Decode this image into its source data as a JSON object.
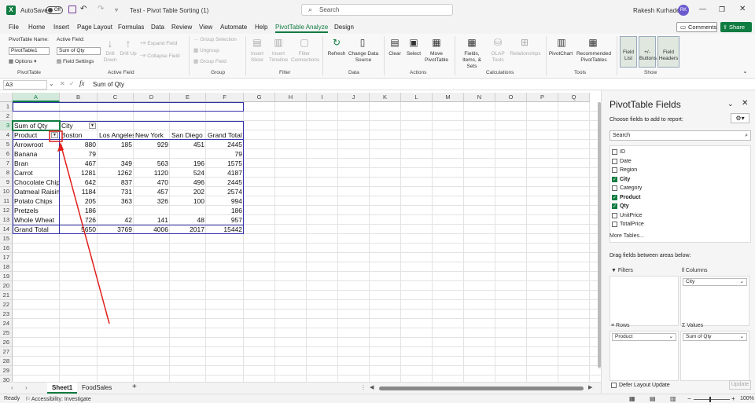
{
  "titlebar": {
    "autosave": "AutoSave",
    "toggle": "Off",
    "title": "Test - Pivot Table Sorting (1)",
    "search": "Search",
    "user": "Rakesh Kurhade",
    "initials": "RK"
  },
  "menu": [
    "File",
    "Home",
    "Insert",
    "Page Layout",
    "Formulas",
    "Data",
    "Review",
    "View",
    "Automate",
    "Help",
    "PivotTable Analyze",
    "Design"
  ],
  "menu_active": "PivotTable Analyze",
  "comments": "Comments",
  "share": "Share",
  "ribbon": {
    "pt_name_label": "PivotTable Name:",
    "pt_name": "PivotTable1",
    "options": "Options",
    "active_field_label": "Active Field:",
    "active_field": "Sum of Qty",
    "field_settings": "Field Settings",
    "drill_down": "Drill Down",
    "drill_up": "Drill Up",
    "expand_field": "Expand Field",
    "collapse_field": "Collapse Field",
    "group_selection": "Group Selection",
    "ungroup": "Ungroup",
    "group_field": "Group Field",
    "insert_slicer": "Insert Slicer",
    "insert_timeline": "Insert Timeline",
    "filter_connections": "Filter Connections",
    "refresh": "Refresh",
    "change_data_source": "Change Data Source",
    "clear": "Clear",
    "select": "Select",
    "move_pivottable": "Move PivotTable",
    "fields_items_sets": "Fields, Items, & Sets",
    "olap_tools": "OLAP Tools",
    "relationships": "Relationships",
    "pivotchart": "PivotChart",
    "recommended_pivottables": "Recommended PivotTables",
    "field_list": "Field List",
    "buttons": "+/- Buttons",
    "field_headers": "Field Headers",
    "groups": [
      "PivotTable",
      "Active Field",
      "Group",
      "Filter",
      "Data",
      "Actions",
      "Calculations",
      "Tools",
      "Show"
    ]
  },
  "formula": {
    "name_box": "A3",
    "fx": "fx",
    "content": "Sum of Qty"
  },
  "columns": [
    "A",
    "B",
    "C",
    "D",
    "E",
    "F",
    "G",
    "H",
    "I",
    "J",
    "K",
    "L",
    "M",
    "N",
    "O",
    "P",
    "Q"
  ],
  "rows": [
    "1",
    "2",
    "3",
    "4",
    "5",
    "6",
    "7",
    "8",
    "9",
    "10",
    "11",
    "12",
    "13",
    "14",
    "15",
    "16",
    "17",
    "18",
    "19",
    "20",
    "21",
    "22",
    "23",
    "24",
    "25",
    "26",
    "27",
    "28",
    "29",
    "30"
  ],
  "pivot": {
    "corner": "Sum of Qty",
    "col_field": "City",
    "row_field": "Product",
    "headers": [
      "Boston",
      "Los Angeles",
      "New York",
      "San Diego",
      "Grand Total"
    ],
    "data": [
      [
        "Arrowroot",
        "880",
        "185",
        "929",
        "451",
        "2445"
      ],
      [
        "Banana",
        "79",
        "",
        "",
        "",
        "79"
      ],
      [
        "Bran",
        "467",
        "349",
        "563",
        "196",
        "1575"
      ],
      [
        "Carrot",
        "1281",
        "1262",
        "1120",
        "524",
        "4187"
      ],
      [
        "Chocolate Chip",
        "642",
        "837",
        "470",
        "496",
        "2445"
      ],
      [
        "Oatmeal Raisin",
        "1184",
        "731",
        "457",
        "202",
        "2574"
      ],
      [
        "Potato Chips",
        "205",
        "363",
        "326",
        "100",
        "994"
      ],
      [
        "Pretzels",
        "186",
        "",
        "",
        "",
        "186"
      ],
      [
        "Whole Wheat",
        "726",
        "42",
        "141",
        "48",
        "957"
      ],
      [
        "Grand Total",
        "5650",
        "3769",
        "4006",
        "2017",
        "15442"
      ]
    ]
  },
  "pane": {
    "title": "PivotTable Fields",
    "choose": "Choose fields to add to report:",
    "search": "Search",
    "fields": [
      {
        "name": "ID",
        "on": false
      },
      {
        "name": "Date",
        "on": false
      },
      {
        "name": "Region",
        "on": false
      },
      {
        "name": "City",
        "on": true
      },
      {
        "name": "Category",
        "on": false
      },
      {
        "name": "Product",
        "on": true
      },
      {
        "name": "Qty",
        "on": true
      },
      {
        "name": "UnitPrice",
        "on": false
      },
      {
        "name": "TotalPrice",
        "on": false
      }
    ],
    "more_tables": "More Tables...",
    "drag": "Drag fields between areas below:",
    "filters": "Filters",
    "columns": "Columns",
    "rows": "Rows",
    "values": "Values",
    "columns_item": "City",
    "rows_item": "Product",
    "values_item": "Sum of Qty",
    "defer": "Defer Layout Update",
    "update": "Update"
  },
  "tabs": {
    "sheet1": "Sheet1",
    "foodsales": "FoodSales",
    "add": "+"
  },
  "status": {
    "ready": "Ready",
    "accessibility": "Accessibility: Investigate",
    "zoom": "100%"
  },
  "colors": {
    "accent": "#107c41",
    "pivot_border": "#3333aa",
    "arrow": "#e0201c"
  }
}
